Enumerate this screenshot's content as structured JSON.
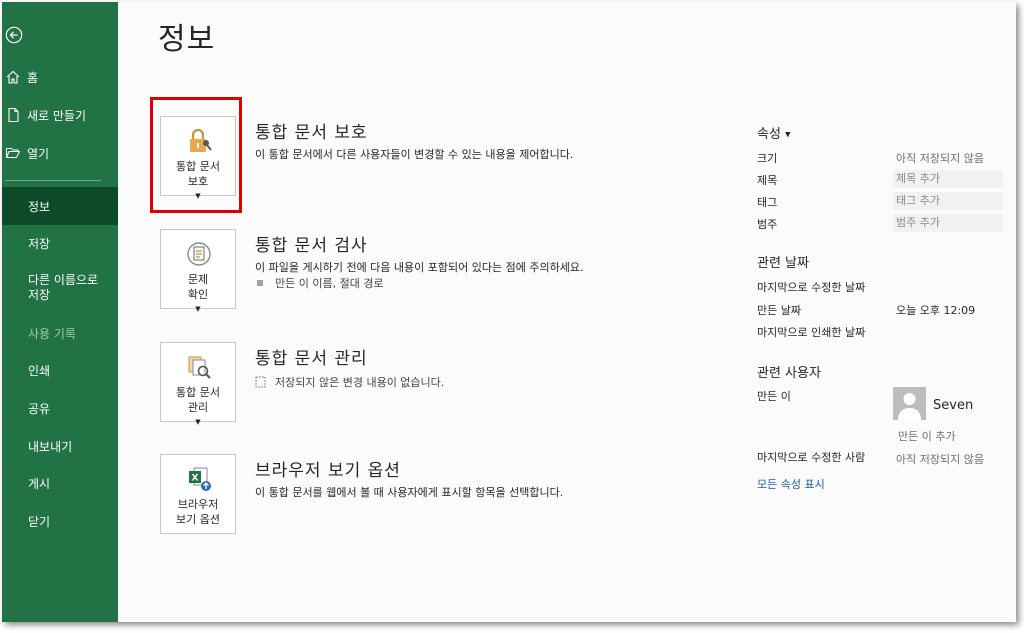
{
  "sidebar": {
    "items": [
      {
        "label": "홈"
      },
      {
        "label": "새로 만들기"
      },
      {
        "label": "열기"
      },
      {
        "label": "정보"
      },
      {
        "label": "저장"
      },
      {
        "label": "다른 이름으로 저장"
      },
      {
        "label": "사용 기록"
      },
      {
        "label": "인쇄"
      },
      {
        "label": "공유"
      },
      {
        "label": "내보내기"
      },
      {
        "label": "게시"
      },
      {
        "label": "닫기"
      }
    ]
  },
  "page": {
    "title": "정보"
  },
  "sections": [
    {
      "tile_line1": "통합 문서",
      "tile_line2": "보호",
      "title": "통합 문서 보호",
      "desc": "이 통합 문서에서 다른 사용자들이 변경할 수 있는 내용을 제어합니다."
    },
    {
      "tile_line1": "문제",
      "tile_line2": "확인",
      "title": "통합 문서 검사",
      "desc": "이 파일을 게시하기 전에 다음 내용이 포함되어 있다는 점에 주의하세요.",
      "bullet": "만든 이 이름, 절대 경로"
    },
    {
      "tile_line1": "통합 문서",
      "tile_line2": "관리",
      "title": "통합 문서 관리",
      "desc": "저장되지 않은 변경 내용이 없습니다."
    },
    {
      "tile_line1": "브라우저",
      "tile_line2": "보기 옵션",
      "title": "브라우저 보기 옵션",
      "desc": "이 통합 문서를 웹에서 볼 때 사용자에게 표시할 항목을 선택합니다."
    }
  ],
  "properties": {
    "heading": "속성",
    "size_label": "크기",
    "size_value": "아직 저장되지 않음",
    "title_label": "제목",
    "title_value": "제목 추가",
    "tags_label": "태그",
    "tags_value": "태그 추가",
    "category_label": "범주",
    "category_value": "범주 추가",
    "dates_heading": "관련 날짜",
    "modified_label": "마지막으로 수정한 날짜",
    "created_label": "만든 날짜",
    "created_value": "오늘 오후 12:09",
    "printed_label": "마지막으로 인쇄한 날짜",
    "people_heading": "관련 사용자",
    "author_label": "만든 이",
    "author_name": "Seven",
    "add_author": "만든 이 추가",
    "last_modified_by_label": "마지막으로 수정한 사람",
    "last_modified_by_value": "아직 저장되지 않음",
    "show_all": "모든 속성 표시"
  },
  "colors": {
    "sidebar": "#217346",
    "active": "#0d4a27",
    "highlight": "#e00000",
    "link": "#1f5ea8"
  }
}
